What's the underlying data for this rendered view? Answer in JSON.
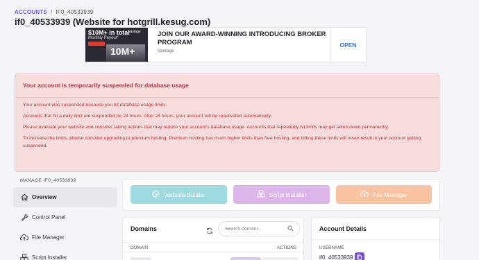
{
  "breadcrumb": {
    "root": "ACCOUNTS",
    "separator": "/",
    "current": "IF0_40533939"
  },
  "page": {
    "title": "if0_40533939 (Website for hotgrill.kesug.com)"
  },
  "ad": {
    "thumb_headline": "$10M+ in total",
    "thumb_sub": "Monthly Payout*",
    "thumb_big": "10M+",
    "thumb_brand": "vantage",
    "headline": "JOIN OUR AWARD-WINNING INTRODUCING BROKER PROGRAM",
    "brand": "Vantage",
    "cta": "OPEN"
  },
  "alert": {
    "title": "Your account is temporarily suspended for database usage",
    "paragraphs": [
      "Your account was suspended because you hit database usage limits.",
      "Accounts that hit a daily limit are suspended for 24 hours. After 24 hours, your account will be reactivated automatically.",
      "Please evaluate your website and consider taking actions that may reduce your account's database usage. Accounts that repeatedly hit limits may get taken down permanently.",
      "To increase the limits, please consider upgrading to premium hosting. Premium hosting has much higher limits than free hosting, and hitting these limits will never result in your account getting suspended."
    ]
  },
  "sidebar": {
    "heading": "MANAGE IF0_40533939",
    "items": [
      {
        "label": "Overview",
        "icon": "home-icon",
        "active": true
      },
      {
        "label": "Control Panel",
        "icon": "wrench-icon",
        "active": false
      },
      {
        "label": "File Manager",
        "icon": "cloud-upload-icon",
        "active": false
      },
      {
        "label": "Script Installer",
        "icon": "cubes-icon",
        "active": false
      }
    ]
  },
  "quick_actions": {
    "website_builder": "Website Builder",
    "script_installer": "Script Installer",
    "file_manager": "File Manager",
    "colors": {
      "builder": "#9edae0",
      "script": "#dcb5ea",
      "files": "#f9c3a2"
    }
  },
  "domains": {
    "title": "Domains",
    "search_placeholder": "Search domain...",
    "col_domain": "DOMAIN",
    "col_actions": "ACTIONS"
  },
  "account": {
    "title": "Account Details",
    "username_label": "USERNAME",
    "username_value": "if0_40533939"
  },
  "colors": {
    "accent": "#7a4fd6",
    "alert_text": "#b8373d",
    "alert_bg": "#f6dcdd"
  }
}
